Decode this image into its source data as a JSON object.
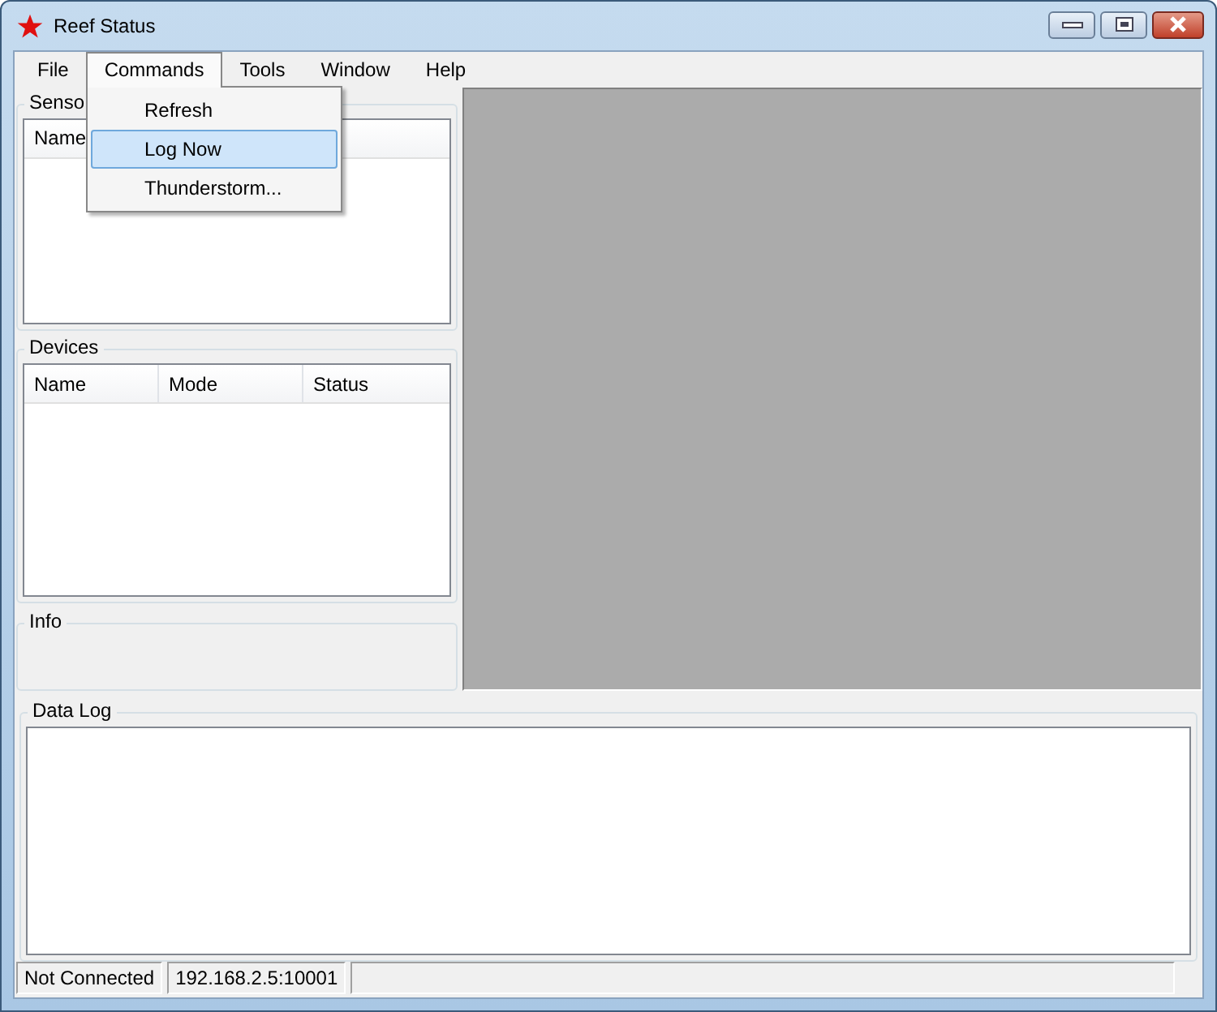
{
  "window": {
    "title": "Reef Status"
  },
  "menu": [
    {
      "label": "File",
      "selected": false
    },
    {
      "label": "Commands",
      "selected": true
    },
    {
      "label": "Tools",
      "selected": false
    },
    {
      "label": "Window",
      "selected": false
    },
    {
      "label": "Help",
      "selected": false
    }
  ],
  "dropdown": [
    {
      "label": "Refresh",
      "selected": false
    },
    {
      "label": "Log Now",
      "selected": true
    },
    {
      "label": "Thunderstorm...",
      "selected": false
    }
  ],
  "sensors": {
    "label": "Senso",
    "columns": [
      "Name"
    ]
  },
  "devices": {
    "label": "Devices",
    "columns": [
      "Name",
      "Mode",
      "Status"
    ]
  },
  "info": {
    "label": "Info"
  },
  "data_log": {
    "label": "Data Log"
  },
  "status_bar": [
    "Not Connected",
    "192.168.2.5:10001"
  ]
}
